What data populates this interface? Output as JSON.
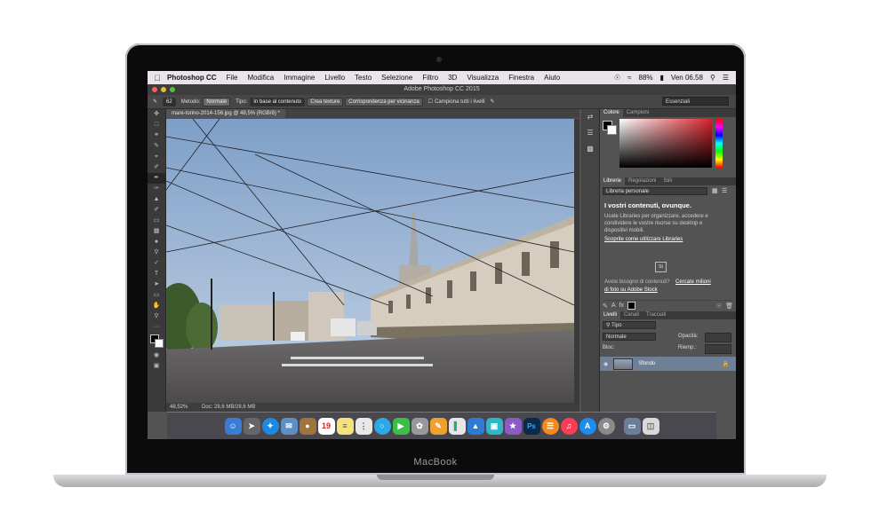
{
  "device": {
    "brand": "MacBook"
  },
  "menubar": {
    "app": "Photoshop CC",
    "items": [
      "File",
      "Modifica",
      "Immagine",
      "Livello",
      "Testo",
      "Selezione",
      "Filtro",
      "3D",
      "Visualizza",
      "Finestra",
      "Aiuto"
    ],
    "battery": "88%",
    "clock": "Ven 06.58"
  },
  "window": {
    "title": "Adobe Photoshop CC 2015"
  },
  "options": {
    "brush_size": "62",
    "metodo_label": "Metodo:",
    "metodo_value": "Normale",
    "tipo_label": "Tipo:",
    "tipo_buttons": [
      "In base al contenuto",
      "Crea texture",
      "Corrispondenza per vicinanza"
    ],
    "sample_all": "Campiona tutti i livelli",
    "workspace": "Essenziali"
  },
  "document": {
    "tab": "mare-torino-2014-156.jpg @ 48,5% (RGB/8) *",
    "zoom": "48,52%",
    "docsize": "Doc: 28,6 MB/28,6 MB"
  },
  "color_panel": {
    "tabs": [
      "Colore",
      "Campioni"
    ],
    "accent": "#d8222a"
  },
  "libraries_panel": {
    "tabs": [
      "Librerie",
      "Regolazioni",
      "Stili"
    ],
    "dropdown": "Libreria personale",
    "heading": "I vostri contenuti, ovunque.",
    "body": "Usate Libraries per organizzare, accedere e condividere le vostre risorse su desktop e dispositivi mobili.",
    "link": "Scoprite come utilizzare Libraries",
    "stock_q": "Avete bisogno di contenuti?",
    "stock_link1": "Cercate milioni",
    "stock_link2": "di foto su Adobe Stock",
    "badge": "St"
  },
  "layers_panel": {
    "tabs": [
      "Livelli",
      "Canali",
      "Tracciati"
    ],
    "filter": "Tipo",
    "blend": "Normale",
    "opacity_label": "Opacità:",
    "lock_label": "Bloc:",
    "fill_label": "Riemp.:",
    "layer_name": "Sfondo"
  },
  "dock": {
    "calendar_day": "19",
    "ps_label": "Ps"
  }
}
